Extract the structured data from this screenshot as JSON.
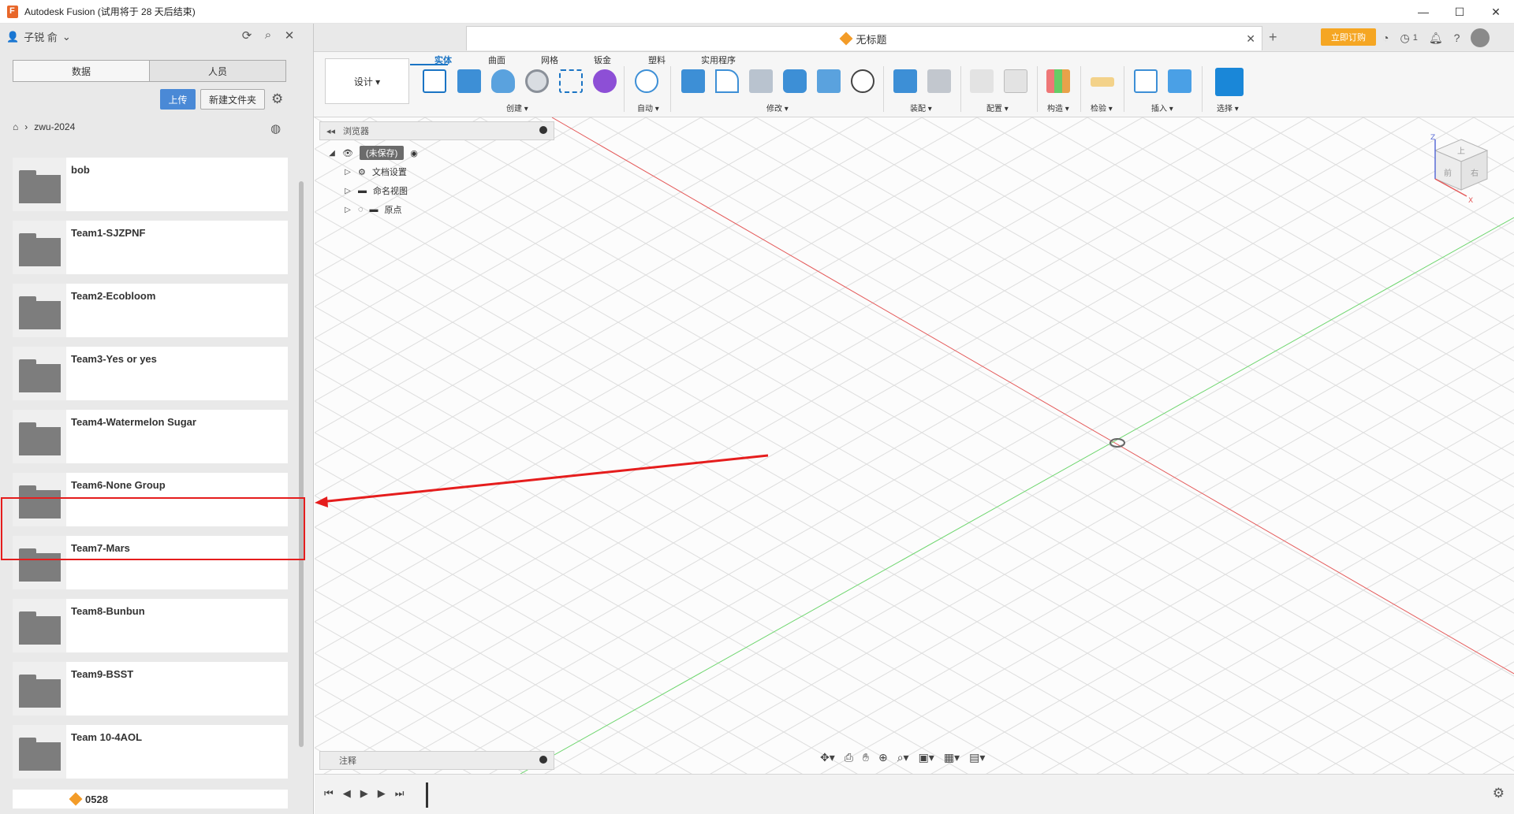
{
  "window": {
    "title": "Autodesk Fusion (试用将于 28 天后结束)",
    "controls": [
      "—",
      "☐",
      "✕"
    ]
  },
  "left_panel": {
    "user_name": "子锐 俞",
    "tabs": {
      "data": "数据",
      "people": "人员"
    },
    "upload_label": "上传",
    "new_folder_label": "新建文件夹",
    "breadcrumb_project": "zwu-2024",
    "folders": [
      {
        "name": "bob"
      },
      {
        "name": "Team1-SJZPNF"
      },
      {
        "name": "Team2-Ecobloom"
      },
      {
        "name": "Team3-Yes or yes"
      },
      {
        "name": "Team4-Watermelon Sugar"
      },
      {
        "name": "Team6-None Group"
      },
      {
        "name": "Team7-Mars"
      },
      {
        "name": "Team8-Bunbun"
      },
      {
        "name": "Team9-BSST"
      },
      {
        "name": "Team 10-4AOL"
      }
    ],
    "last_design": "0528",
    "highlighted_folder": "Team6-None Group"
  },
  "tabbar": {
    "document_title": "无标题",
    "subscribe_label": "立即订购",
    "job_count": "1"
  },
  "ribbon": {
    "workspace_label": "设计 ▾",
    "tabs": [
      "实体",
      "曲面",
      "网格",
      "钣金",
      "塑料",
      "实用程序"
    ],
    "active_tab": "实体",
    "groups": {
      "create": "创建 ▾",
      "automate": "自动 ▾",
      "modify": "修改 ▾",
      "assemble": "装配 ▾",
      "configure": "配置 ▾",
      "construct": "构造 ▾",
      "inspect": "检验 ▾",
      "insert": "插入 ▾",
      "select": "选择 ▾"
    }
  },
  "browser": {
    "title": "浏览器",
    "root_label": "(未保存)",
    "items": [
      "文档设置",
      "命名视图",
      "原点"
    ]
  },
  "comments": {
    "label": "注释"
  },
  "viewcube": {
    "top": "上",
    "front": "前",
    "right": "右",
    "axis_z": "Z",
    "axis_x": "X"
  },
  "colors": {
    "accent": "#1a74c4",
    "subscribe": "#f5a623",
    "highlight": "#e51d1d",
    "x_axis": "#e45a5a",
    "y_axis": "#6fd66f"
  }
}
